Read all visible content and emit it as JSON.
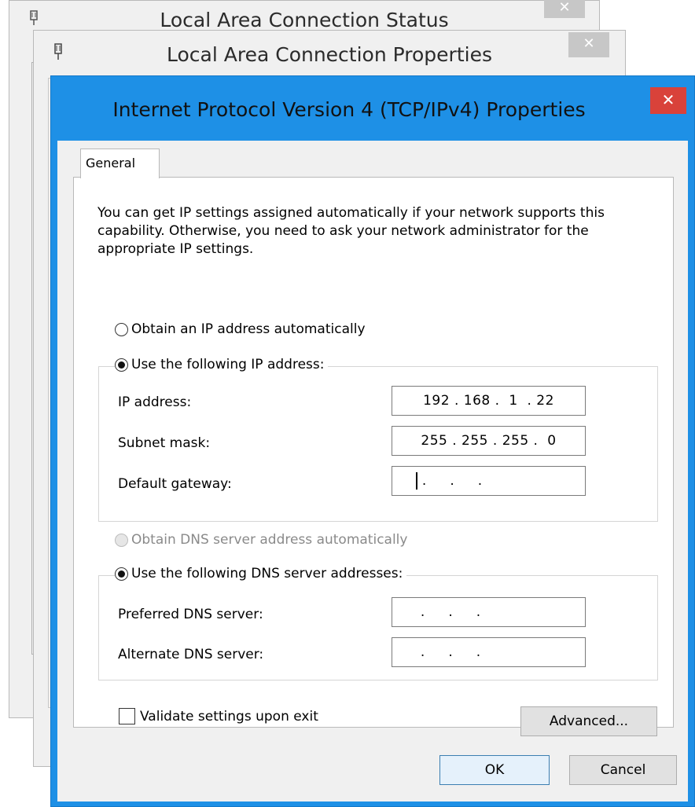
{
  "back_window_1": {
    "title": "Local Area Connection Status",
    "close": "✕"
  },
  "back_window_2": {
    "title": "Local Area Connection Properties",
    "close": "✕"
  },
  "dialog": {
    "title": "Internet Protocol Version 4 (TCP/IPv4) Properties",
    "close": "✕",
    "tabs": [
      {
        "label": "General",
        "selected": true
      }
    ],
    "description": "You can get IP settings assigned automatically if your network supports this capability. Otherwise, you need to ask your network administrator for the appropriate IP settings.",
    "ip_mode": {
      "auto_label": "Obtain an IP address automatically",
      "manual_label": "Use the following IP address:",
      "selected": "manual"
    },
    "ip_fields": {
      "ip_address": {
        "label": "IP address:",
        "value": "192 . 168 .  1  . 22"
      },
      "subnet_mask": {
        "label": "Subnet mask:",
        "value": "255 . 255 . 255 .  0"
      },
      "default_gateway": {
        "label": "Default gateway:",
        "value": " .     .     ."
      }
    },
    "dns_mode": {
      "auto_label": "Obtain DNS server address automatically",
      "auto_enabled": false,
      "manual_label": "Use the following DNS server addresses:",
      "selected": "manual"
    },
    "dns_fields": {
      "preferred": {
        "label": "Preferred DNS server:",
        "value": " .     .     ."
      },
      "alternate": {
        "label": "Alternate DNS server:",
        "value": " .     .     ."
      }
    },
    "validate_label": "Validate settings upon exit",
    "validate_checked": false,
    "advanced_button": "Advanced...",
    "ok_button": "OK",
    "cancel_button": "Cancel"
  },
  "colors": {
    "title_bar_active": "#1e90e6",
    "close_button_active": "#d9423a",
    "dialog_background": "#f0f0f0"
  }
}
